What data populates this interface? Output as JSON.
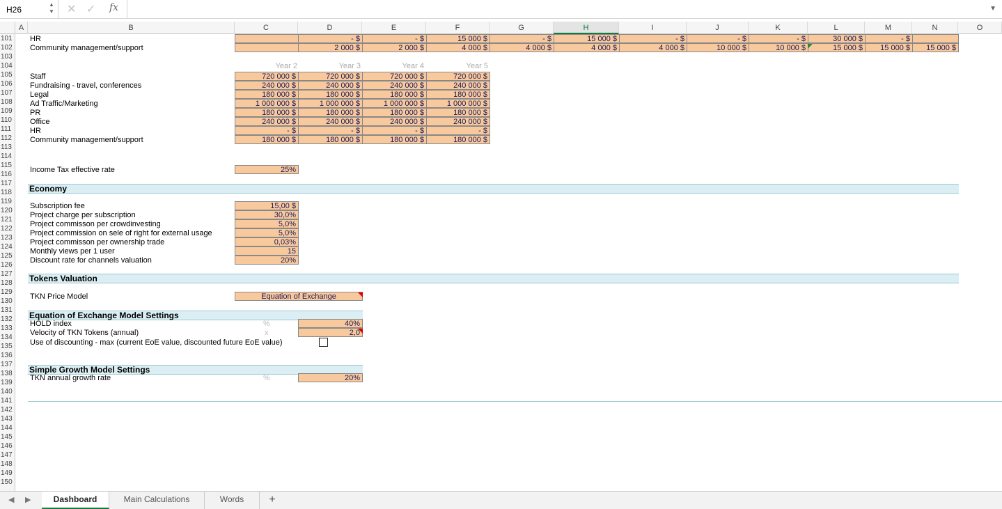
{
  "formula_bar": {
    "name_box": "H26",
    "fx": "fx",
    "formula": ""
  },
  "columns": [
    "A",
    "B",
    "C",
    "D",
    "E",
    "F",
    "G",
    "H",
    "I",
    "J",
    "K",
    "L",
    "M",
    "N",
    "O"
  ],
  "active_column": "H",
  "rows": [
    "101",
    "102",
    "103",
    "104",
    "105",
    "106",
    "107",
    "108",
    "109",
    "110",
    "111",
    "112",
    "113",
    "114",
    "115",
    "116",
    "117",
    "118",
    "119",
    "120",
    "121",
    "122",
    "123",
    "124",
    "125",
    "126",
    "127",
    "128",
    "129",
    "130",
    "131",
    "132",
    "133",
    "134",
    "135",
    "136",
    "137",
    "138",
    "139",
    "140",
    "141",
    "142",
    "143",
    "144",
    "145",
    "146",
    "147",
    "148",
    "149",
    "150"
  ],
  "top_rows": {
    "r101": {
      "label": "HR",
      "values": [
        "",
        "-   $",
        "-   $",
        "15 000 $",
        "-   $",
        "15 000 $",
        "-   $",
        "-   $",
        "-   $",
        "30 000 $",
        "-   $",
        ""
      ]
    },
    "r102": {
      "label": "Community management/support",
      "values": [
        "",
        "2 000 $",
        "2 000 $",
        "4 000 $",
        "4 000 $",
        "4 000 $",
        "4 000 $",
        "10 000 $",
        "10 000 $",
        "15 000 $",
        "15 000 $",
        "15 000 $"
      ]
    }
  },
  "years": [
    "Year 2",
    "Year 3",
    "Year 4",
    "Year 5"
  ],
  "expenses": [
    {
      "label": "Staff",
      "values": [
        "720 000 $",
        "720 000 $",
        "720 000 $",
        "720 000 $"
      ]
    },
    {
      "label": "Fundraising - travel, conferences",
      "values": [
        "240 000 $",
        "240 000 $",
        "240 000 $",
        "240 000 $"
      ]
    },
    {
      "label": "Legal",
      "values": [
        "180 000 $",
        "180 000 $",
        "180 000 $",
        "180 000 $"
      ]
    },
    {
      "label": "Ad Traffic/Marketing",
      "values": [
        "1 000 000 $",
        "1 000 000 $",
        "1 000 000 $",
        "1 000 000 $"
      ]
    },
    {
      "label": "PR",
      "values": [
        "180 000 $",
        "180 000 $",
        "180 000 $",
        "180 000 $"
      ]
    },
    {
      "label": "Office",
      "values": [
        "240 000 $",
        "240 000 $",
        "240 000 $",
        "240 000 $"
      ]
    },
    {
      "label": "HR",
      "values": [
        "-   $",
        "-   $",
        "-   $",
        "-   $"
      ]
    },
    {
      "label": "Community management/support",
      "values": [
        "180 000 $",
        "180 000 $",
        "180 000 $",
        "180 000 $"
      ]
    }
  ],
  "income_tax": {
    "label": "Income Tax effective rate",
    "value": "25%"
  },
  "economy": {
    "title": "Economy",
    "items": [
      {
        "label": "Subscription fee",
        "value": "15,00 $"
      },
      {
        "label": "Project charge per subscription",
        "value": "30,0%"
      },
      {
        "label": "Project commisson per crowdinvesting",
        "value": "5,0%"
      },
      {
        "label": "Project commission on sele of right for external usage",
        "value": "5,0%"
      },
      {
        "label": "Project commisson per ownership trade",
        "value": "0,03%"
      },
      {
        "label": "Monthly views per 1 user",
        "value": "15"
      },
      {
        "label": "Discount rate for channels valuation",
        "value": "20%"
      }
    ]
  },
  "tokens": {
    "title": "Tokens Valuation",
    "price_model_label": "TKN Price Model",
    "price_model_value": "Equation of Exchange"
  },
  "eoe": {
    "title": "Equation of Exchange Model Settings",
    "hold_label": "HOLD index",
    "hold_unit": "%",
    "hold_value": "40%",
    "velocity_label": "Velocity of TKN Tokens (annual)",
    "velocity_unit": "x",
    "velocity_value": "2,0",
    "discount_label": "Use of discounting - max (current EoE value, discounted future EoE value)"
  },
  "simple_growth": {
    "title": "Simple Growth Model Settings",
    "rate_label": "TKN annual growth rate",
    "rate_unit": "%",
    "rate_value": "20%"
  },
  "tabs": [
    "Dashboard",
    "Main Calculations",
    "Words"
  ],
  "add_tab": "+",
  "colors": {
    "input_fill": "#f9c99e",
    "section_fill": "#daeef3",
    "active_accent": "#107c41"
  }
}
